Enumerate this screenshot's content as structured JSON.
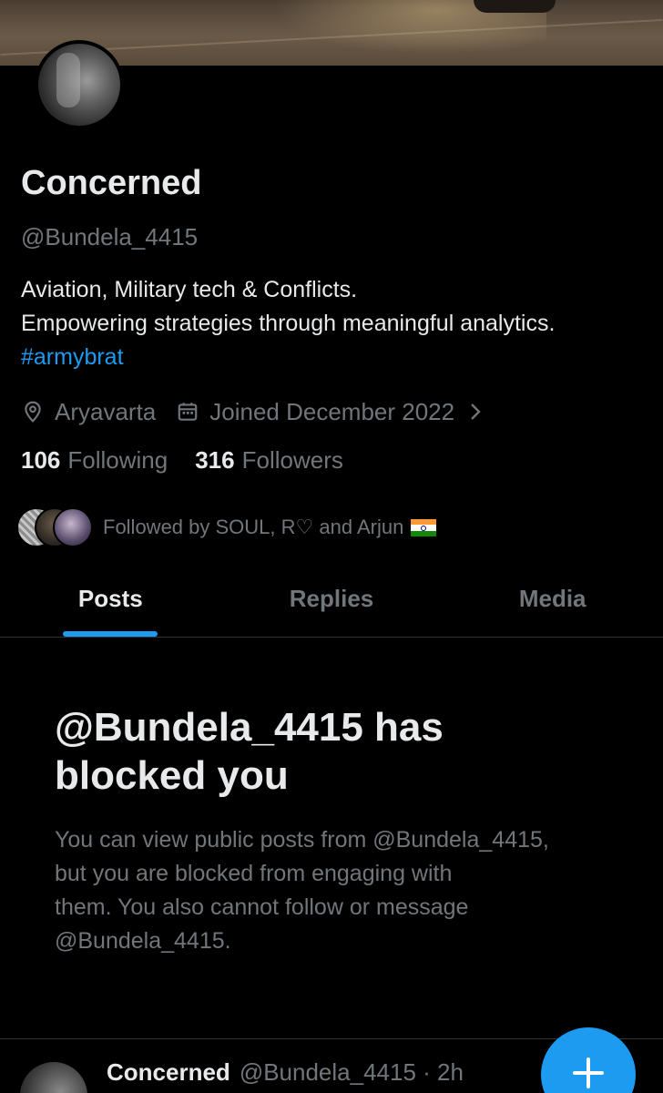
{
  "profile": {
    "display_name": "Concerned",
    "handle": "@Bundela_4415",
    "bio_lines": [
      "Aviation, Military tech & Conflicts.",
      "Empowering strategies through meaningful analytics."
    ],
    "hashtag": "#armybrat",
    "location": "Aryavarta",
    "joined": "Joined December 2022",
    "following_count": "106",
    "following_label": "Following",
    "followers_count": "316",
    "followers_label": "Followers",
    "followed_by": "Followed by SOUL, R♡ and Arjun"
  },
  "tabs": [
    {
      "label": "Posts",
      "active": true
    },
    {
      "label": "Replies",
      "active": false
    },
    {
      "label": "Media",
      "active": false
    }
  ],
  "blocked": {
    "title_lines": [
      "@Bundela_4415 has",
      "blocked you"
    ],
    "description_lines": [
      "You can view public posts from @Bundela_4415,",
      "but you are blocked from engaging with",
      "them. You also cannot follow or message",
      "@Bundela_4415."
    ]
  },
  "post_preview": {
    "name": "Concerned",
    "handle_time": "@Bundela_4415 · 2h"
  },
  "icons": {
    "location": "location-pin-icon",
    "calendar": "calendar-icon",
    "chevron": "chevron-right-icon",
    "fab": "plus-icon",
    "flag": "india-flag-icon"
  },
  "colors": {
    "accent": "#1d9bf0",
    "background": "#000000",
    "text_primary": "#e7e9ea",
    "text_secondary": "#71767b"
  }
}
